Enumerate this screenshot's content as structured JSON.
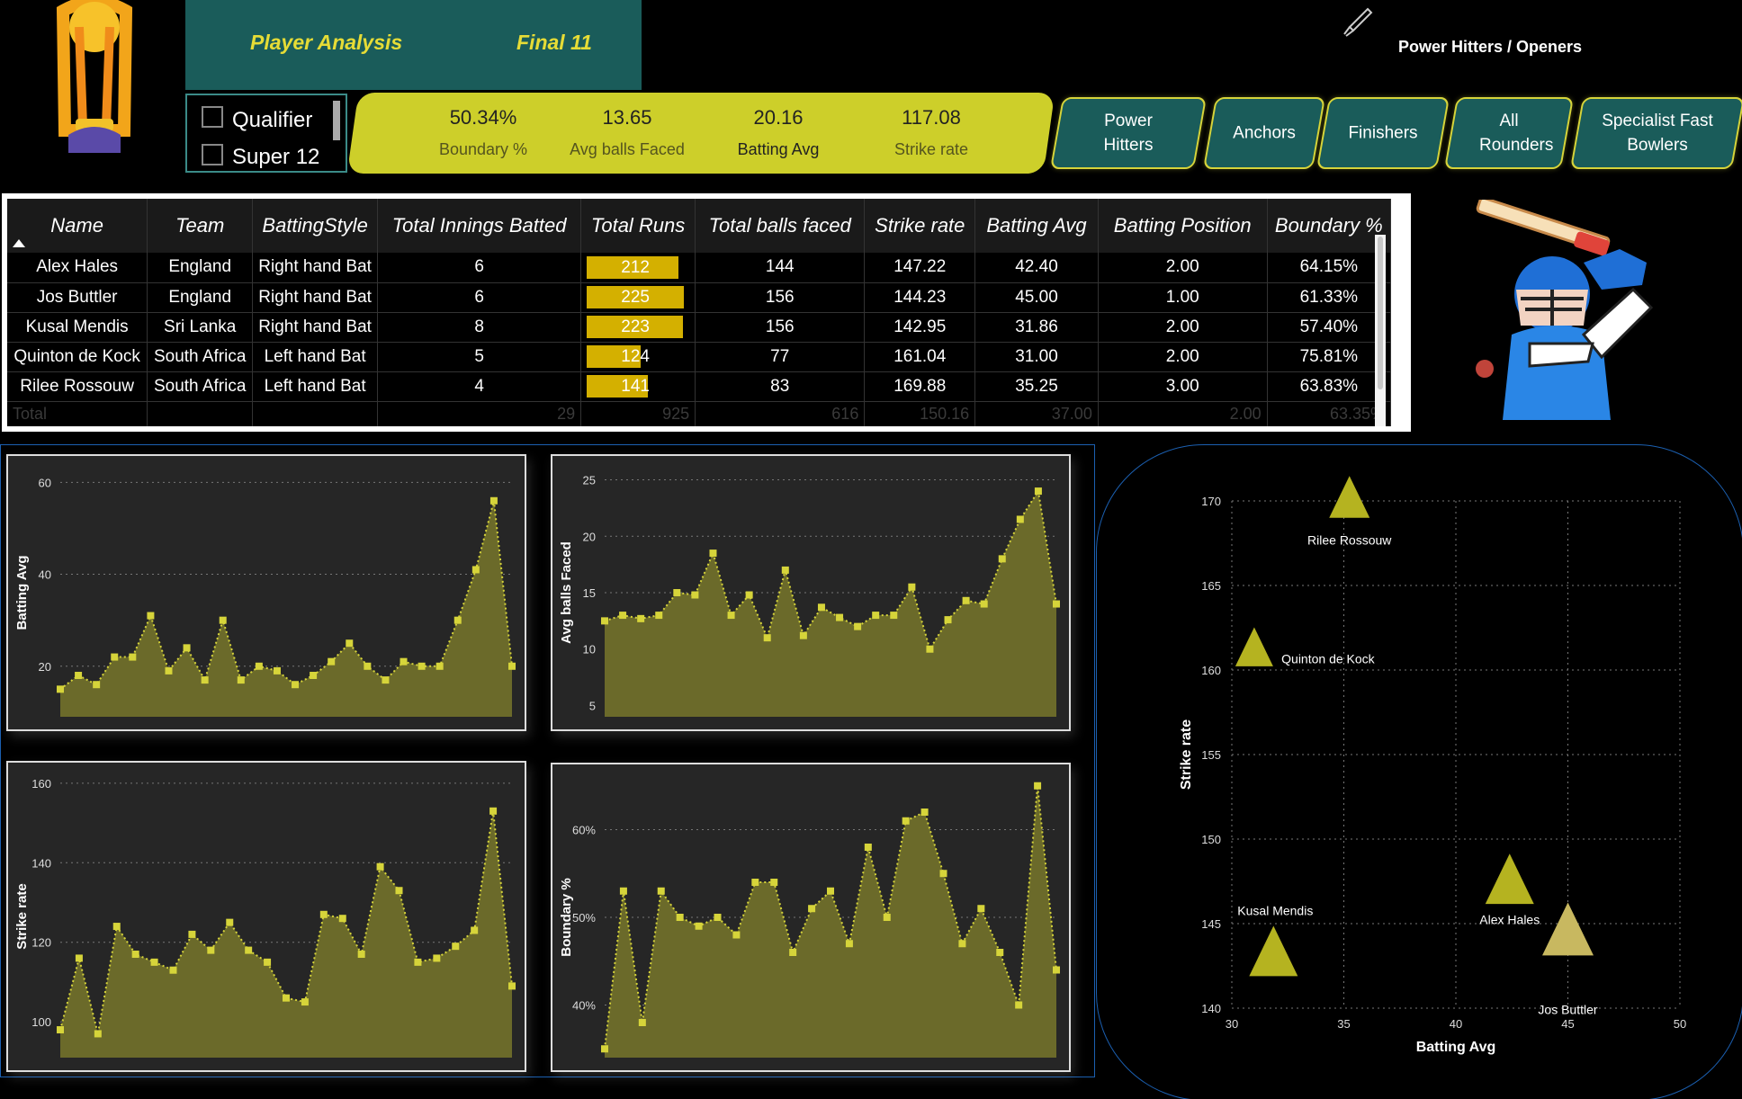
{
  "nav": {
    "player_analysis": "Player Analysis",
    "final11": "Final 11"
  },
  "filter": {
    "options": [
      "Qualifier",
      "Super 12"
    ]
  },
  "kpis": [
    {
      "value": "50.34%",
      "label": "Boundary %"
    },
    {
      "value": "13.65",
      "label": "Avg balls Faced"
    },
    {
      "value": "20.16",
      "label": "Batting Avg"
    },
    {
      "value": "117.08",
      "label": "Strike rate"
    }
  ],
  "category_buttons": [
    "Power Hitters",
    "Anchors",
    "Finishers",
    "All Rounders",
    "Specialist Fast Bowlers"
  ],
  "page_title": "Power Hitters / Openers",
  "table": {
    "headers": [
      "Name",
      "Team",
      "BattingStyle",
      "Total Innings Batted",
      "Total Runs",
      "Total balls faced",
      "Strike rate",
      "Batting Avg",
      "Batting Position",
      "Boundary %"
    ],
    "rows": [
      {
        "name": "Alex Hales",
        "team": "England",
        "style": "Right hand Bat",
        "innings": "6",
        "runs": "212",
        "balls": "144",
        "sr": "147.22",
        "avg": "42.40",
        "pos": "2.00",
        "boundary": "64.15%"
      },
      {
        "name": "Jos Buttler",
        "team": "England",
        "style": "Right hand Bat",
        "innings": "6",
        "runs": "225",
        "balls": "156",
        "sr": "144.23",
        "avg": "45.00",
        "pos": "1.00",
        "boundary": "61.33%"
      },
      {
        "name": "Kusal Mendis",
        "team": "Sri Lanka",
        "style": "Right hand Bat",
        "innings": "8",
        "runs": "223",
        "balls": "156",
        "sr": "142.95",
        "avg": "31.86",
        "pos": "2.00",
        "boundary": "57.40%"
      },
      {
        "name": "Quinton de Kock",
        "team": "South Africa",
        "style": "Left hand Bat",
        "innings": "5",
        "runs": "124",
        "balls": "77",
        "sr": "161.04",
        "avg": "31.00",
        "pos": "2.00",
        "boundary": "75.81%"
      },
      {
        "name": "Rilee Rossouw",
        "team": "South Africa",
        "style": "Left hand Bat",
        "innings": "4",
        "runs": "141",
        "balls": "83",
        "sr": "169.88",
        "avg": "35.25",
        "pos": "3.00",
        "boundary": "63.83%"
      }
    ],
    "total": {
      "label": "Total",
      "innings": "29",
      "runs": "925",
      "balls": "616",
      "sr": "150.16",
      "avg": "37.00",
      "pos": "2.00",
      "boundary": "63.35%"
    },
    "runs_max": 225
  },
  "colors": {
    "accent": "#cdcf2a",
    "teal": "#1a5c5a",
    "series": "#d6d43a",
    "fill": "#6b6a2a",
    "runbar": "#d4b000"
  },
  "chart_data": [
    {
      "type": "area",
      "ylabel": "Batting Avg",
      "yticks": [
        20,
        40,
        60
      ],
      "ylim": [
        9,
        63
      ],
      "values": [
        15,
        18,
        16,
        22,
        22,
        31,
        19,
        24,
        17,
        30,
        17,
        20,
        19,
        16,
        18,
        21,
        25,
        20,
        17,
        21,
        20,
        20,
        30,
        41,
        56,
        20
      ]
    },
    {
      "type": "area",
      "ylabel": "Avg balls Faced",
      "yticks": [
        5,
        10,
        15,
        20,
        25
      ],
      "ylim": [
        4,
        26
      ],
      "values": [
        12.5,
        13,
        12.7,
        13,
        15,
        14.8,
        18.5,
        13,
        14.8,
        11,
        17,
        11.2,
        13.7,
        12.8,
        12,
        13,
        13,
        15.5,
        10,
        12.6,
        14.3,
        14,
        18,
        21.5,
        24,
        14
      ]
    },
    {
      "type": "area",
      "ylabel": "Strike rate",
      "yticks": [
        100,
        120,
        140,
        160
      ],
      "ylim": [
        91,
        162
      ],
      "values": [
        98,
        116,
        97,
        124,
        117,
        115,
        113,
        122,
        118,
        125,
        118,
        115,
        106,
        105,
        127,
        126,
        117,
        139,
        133,
        115,
        116,
        119,
        123,
        153,
        109
      ]
    },
    {
      "type": "area",
      "ylabel": "Boundary %",
      "yticks": [
        "40%",
        "50%",
        "60%"
      ],
      "yvals": [
        40,
        50,
        60
      ],
      "ylim": [
        34,
        66
      ],
      "values": [
        35,
        53,
        38,
        53,
        50,
        49,
        50,
        48,
        54,
        54,
        46,
        51,
        53,
        47,
        58,
        50,
        61,
        62,
        55,
        47,
        51,
        46,
        40,
        65,
        44
      ]
    },
    {
      "type": "scatter",
      "xlabel": "Batting Avg",
      "ylabel": "Strike rate",
      "xlim": [
        30,
        50
      ],
      "ylim": [
        140,
        170
      ],
      "xticks": [
        30,
        35,
        40,
        45,
        50
      ],
      "yticks": [
        140,
        145,
        150,
        155,
        160,
        165,
        170
      ],
      "points": [
        {
          "name": "Rilee Rossouw",
          "x": 35.25,
          "y": 169.88
        },
        {
          "name": "Quinton de Kock",
          "x": 31.0,
          "y": 161.04
        },
        {
          "name": "Alex Hales",
          "x": 42.4,
          "y": 147.22
        },
        {
          "name": "Jos Buttler",
          "x": 45.0,
          "y": 144.23
        },
        {
          "name": "Kusal Mendis",
          "x": 31.86,
          "y": 142.95
        }
      ]
    }
  ]
}
